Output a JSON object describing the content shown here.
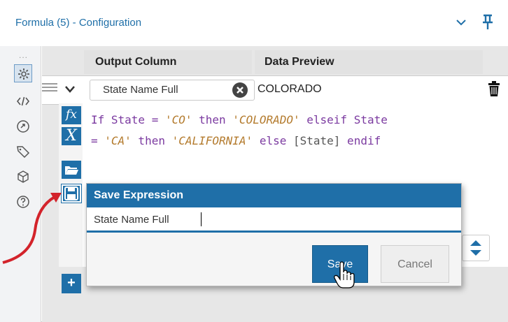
{
  "window": {
    "title": "Formula (5) - Configuration"
  },
  "grid": {
    "headers": {
      "output_column": "Output Column",
      "data_preview": "Data Preview"
    },
    "row": {
      "output_column_value": "State Name Full",
      "preview_value": "COLORADO"
    }
  },
  "expression": {
    "line1": {
      "a": "If State = ",
      "b": "'CO'",
      "c": " then ",
      "d": "'COLORADO'",
      "e": " elseif State"
    },
    "line2": {
      "a": "= ",
      "b": "'CA'",
      "c": " then ",
      "d": "'CALIFORNIA'",
      "e": " else ",
      "f": "[State]",
      "g": " endif"
    }
  },
  "toolbar": {
    "fx_label": "fx",
    "var_label": "X"
  },
  "save_dialog": {
    "title": "Save Expression",
    "name_value": "State Name Full",
    "save_label": "Save",
    "cancel_label": "Cancel"
  },
  "sidebar": {
    "dots": "..."
  },
  "add_row_label": "+",
  "colors": {
    "accent": "#1f6fa8",
    "annotation_arrow": "#d3232b"
  }
}
